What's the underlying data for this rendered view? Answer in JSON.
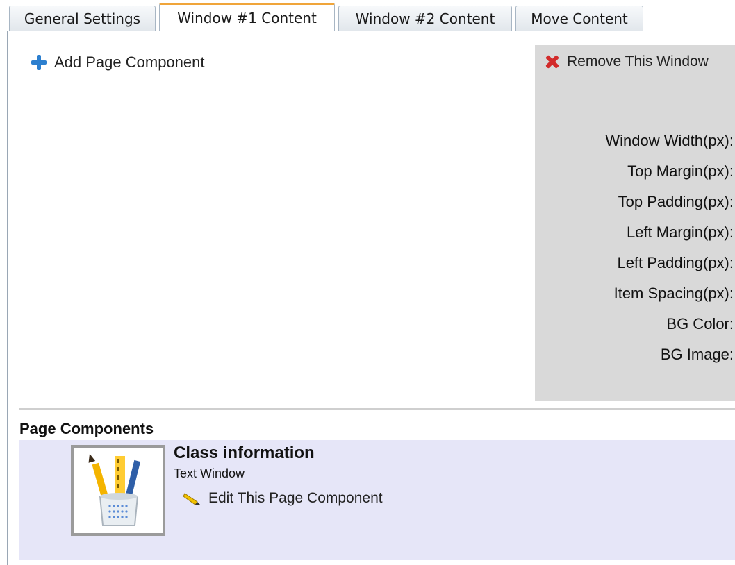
{
  "tabs": [
    {
      "label": "General Settings",
      "active": false
    },
    {
      "label": "Window #1 Content",
      "active": true
    },
    {
      "label": "Window #2 Content",
      "active": false
    },
    {
      "label": "Move Content",
      "active": false
    }
  ],
  "main": {
    "add_component_label": "Add Page Component",
    "remove_window_label": "Remove This Window",
    "window_settings": [
      "Window Width(px):",
      "Top Margin(px):",
      "Top Padding(px):",
      "Left Margin(px):",
      "Left Padding(px):",
      "Item Spacing(px):",
      "BG Color:",
      "BG Image:"
    ]
  },
  "components": {
    "heading": "Page Components",
    "items": [
      {
        "title": "Class information",
        "type": "Text Window",
        "edit_label": "Edit This Page Component",
        "icon": "pencil-cup-icon"
      }
    ]
  },
  "colors": {
    "accent_tab": "#f0a53a",
    "add_icon": "#2c7fcf",
    "remove_icon": "#d22b2b",
    "settings_bg": "#d9d9d9",
    "component_bg": "#e6e6f8"
  }
}
